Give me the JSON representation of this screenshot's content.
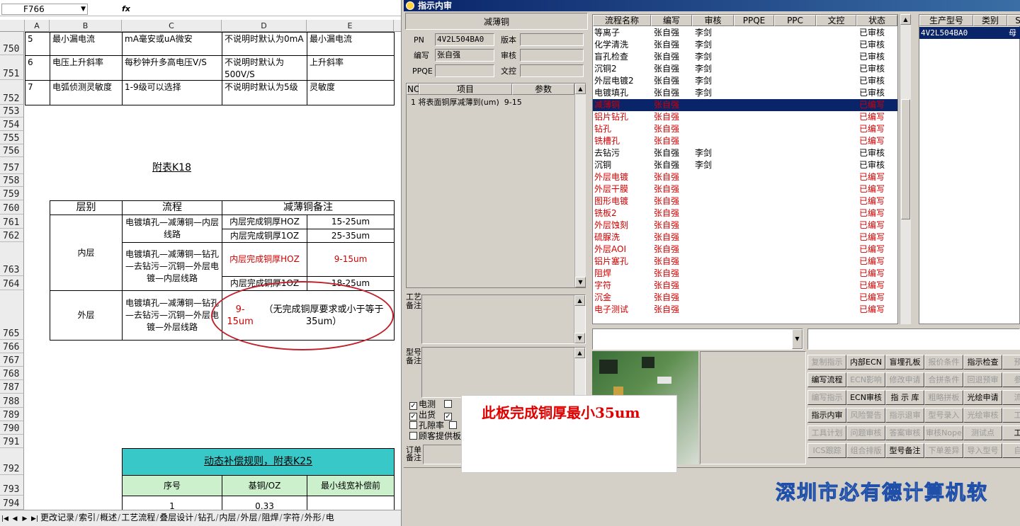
{
  "excel": {
    "name_box": "F766",
    "fx": "fx",
    "columns": [
      "A",
      "B",
      "C",
      "D",
      "E"
    ],
    "rows": [
      "750",
      "751",
      "752",
      "753",
      "754",
      "755",
      "756",
      "757",
      "758",
      "759",
      "760",
      "761",
      "762",
      "763",
      "764",
      "765",
      "766",
      "767",
      "768",
      "787",
      "788",
      "789",
      "790",
      "791",
      "792",
      "793",
      "794"
    ],
    "top_table": [
      {
        "a": "5",
        "b": "最小漏电流",
        "c": "mA毫安或uA微安",
        "d": "不说明时默认为0mA",
        "e": "最小漏电流"
      },
      {
        "a": "6",
        "b": "电压上升斜率",
        "c": "每秒钟升多高电压V/S",
        "d": "不说明时默认为500V/S",
        "e": "上升斜率"
      },
      {
        "a": "7",
        "b": "电弧侦测灵敏度",
        "c": "1-9级可以选择",
        "d": "不说明时默认为5级",
        "e": "灵敏度"
      }
    ],
    "appendix_title": "附表K18",
    "k18": {
      "header": {
        "layer": "层别",
        "flow": "流程",
        "note": "减薄铜备注"
      },
      "inner_label": "内层",
      "inner_flow_1": "电镀填孔—减薄铜—内层线路",
      "inner_flow_2": "电镀填孔—减薄铜—钻孔—去钻污—沉铜—外层电镀—内层线路",
      "inner_rows": [
        {
          "cond": "内层完成铜厚HOZ",
          "val": "15-25um"
        },
        {
          "cond": "内层完成铜厚1OZ",
          "val": "25-35um"
        },
        {
          "cond": "内层完成铜厚HOZ",
          "val": "9-15um"
        },
        {
          "cond": "内层完成铜厚1OZ",
          "val": "18-25um"
        }
      ],
      "outer_label": "外层",
      "outer_flow": "电镀填孔—减薄铜—钻孔—去钻污—沉铜—外层电镀—外层线路",
      "outer_note_red": "9-15um",
      "outer_note": "（无完成铜厚要求或小于等于35um）"
    },
    "comp_table": {
      "title": "动态补偿规则，附表K25",
      "headers": [
        "序号",
        "基铜/OZ",
        "最小线宽补偿前"
      ],
      "row": [
        "1",
        "0.33",
        ""
      ]
    },
    "sheet_tabs": [
      "更改记录",
      "索引",
      "概述",
      "工艺流程",
      "叠层设计",
      "钻孔",
      "内层",
      "外层",
      "阻焊",
      "字符",
      "外形",
      "电"
    ]
  },
  "window": {
    "title": "指示内审",
    "process_name": "减薄铜",
    "pn_label": "PN",
    "pn_value": "4V2L504BA0",
    "version_label": "版本",
    "author_label": "编写",
    "author_value": "张自强",
    "review_label": "审核",
    "ppqe_label": "PPQE",
    "wenkong_label": "文控",
    "items_headers": [
      "NO",
      "项目",
      "参数"
    ],
    "items": [
      {
        "no": "1",
        "item": "将表面铜厚减薄到(um)",
        "param": "9-15"
      }
    ],
    "craft_note_label": "工艺备注",
    "model_note_label": "型号备注",
    "order_note_label": "订单备注",
    "checks": [
      {
        "label": "电测",
        "checked": true
      },
      {
        "label": "出货",
        "checked": true
      },
      {
        "label": "孔隙率",
        "checked": false
      },
      {
        "label": "顾客提供板",
        "checked": false
      }
    ],
    "flow_headers": [
      "流程名称",
      "编写",
      "审核",
      "PPQE",
      "PPC",
      "文控",
      "状态"
    ],
    "flow_rows": [
      {
        "name": "等离子",
        "author": "张自强",
        "reviewer": "李剑",
        "status": "已审核",
        "red": false
      },
      {
        "name": "化学清洗",
        "author": "张自强",
        "reviewer": "李剑",
        "status": "已审核",
        "red": false
      },
      {
        "name": "盲孔检查",
        "author": "张自强",
        "reviewer": "李剑",
        "status": "已审核",
        "red": false
      },
      {
        "name": "沉铜2",
        "author": "张自强",
        "reviewer": "李剑",
        "status": "已审核",
        "red": false
      },
      {
        "name": "外层电镀2",
        "author": "张自强",
        "reviewer": "李剑",
        "status": "已审核",
        "red": false
      },
      {
        "name": "电镀填孔",
        "author": "张自强",
        "reviewer": "李剑",
        "status": "已审核",
        "red": false
      },
      {
        "name": "减薄铜",
        "author": "张自强",
        "reviewer": "",
        "status": "已编写",
        "red": true
      },
      {
        "name": "铝片钻孔",
        "author": "张自强",
        "reviewer": "",
        "status": "已编写",
        "red": true
      },
      {
        "name": "钻孔",
        "author": "张自强",
        "reviewer": "",
        "status": "已编写",
        "red": true
      },
      {
        "name": "铣槽孔",
        "author": "张自强",
        "reviewer": "",
        "status": "已编写",
        "red": true
      },
      {
        "name": "去钻污",
        "author": "张自强",
        "reviewer": "李剑",
        "status": "已审核",
        "red": false
      },
      {
        "name": "沉铜",
        "author": "张自强",
        "reviewer": "李剑",
        "status": "已审核",
        "red": false
      },
      {
        "name": "外层电镀",
        "author": "张自强",
        "reviewer": "",
        "status": "已编写",
        "red": true
      },
      {
        "name": "外层干膜",
        "author": "张自强",
        "reviewer": "",
        "status": "已编写",
        "red": true
      },
      {
        "name": "图形电镀",
        "author": "张自强",
        "reviewer": "",
        "status": "已编写",
        "red": true
      },
      {
        "name": "铣板2",
        "author": "张自强",
        "reviewer": "",
        "status": "已编写",
        "red": true
      },
      {
        "name": "外层蚀刻",
        "author": "张自强",
        "reviewer": "",
        "status": "已编写",
        "red": true
      },
      {
        "name": "硫脲洗",
        "author": "张自强",
        "reviewer": "",
        "status": "已编写",
        "red": true
      },
      {
        "name": "外层AOI",
        "author": "张自强",
        "reviewer": "",
        "status": "已编写",
        "red": true
      },
      {
        "name": "铝片塞孔",
        "author": "张自强",
        "reviewer": "",
        "status": "已编写",
        "red": true
      },
      {
        "name": "阻焊",
        "author": "张自强",
        "reviewer": "",
        "status": "已编写",
        "red": true
      },
      {
        "name": "字符",
        "author": "张自强",
        "reviewer": "",
        "status": "已编写",
        "red": true
      },
      {
        "name": "沉金",
        "author": "张自强",
        "reviewer": "",
        "status": "已编写",
        "red": true
      },
      {
        "name": "电子测试",
        "author": "张自强",
        "reviewer": "",
        "status": "已编写",
        "red": true
      }
    ],
    "model_headers": [
      "生产型号",
      "类别",
      "S"
    ],
    "model_row": {
      "model": "4V2L504BA0",
      "type": "",
      "s": "母"
    },
    "buttons": [
      [
        "复制指示",
        "内部ECN",
        "盲埋孔板",
        "报价条件",
        "指示检查",
        "预审"
      ],
      [
        "编写流程",
        "ECN影响",
        "修改申请",
        "合拼条件",
        "回退预审",
        "参数"
      ],
      [
        "编写指示",
        "ECN审核",
        "指 示 库",
        "粗略拼板",
        "光绘申请",
        "流程"
      ],
      [
        "指示内审",
        "风险警告",
        "指示退审",
        "型号录入",
        "光绘审核",
        "工具"
      ],
      [
        "工具计划",
        "问题审核",
        "答案审核",
        "审核Nope",
        "测试点",
        "工具"
      ],
      [
        "ICS跟踪",
        "组合排版",
        "型号备注",
        "下单差异",
        "导入型号",
        "自定"
      ]
    ],
    "buttons_disabled": [
      [
        true,
        false,
        false,
        true,
        false,
        true
      ],
      [
        false,
        true,
        true,
        true,
        true,
        true
      ],
      [
        true,
        false,
        false,
        true,
        false,
        true
      ],
      [
        false,
        true,
        true,
        true,
        true,
        true
      ],
      [
        true,
        true,
        true,
        true,
        true,
        false
      ],
      [
        true,
        true,
        false,
        true,
        true,
        true
      ]
    ],
    "note_text": "此板完成铜厚最小35um",
    "banner_text": "深圳市必有德计算机软"
  }
}
